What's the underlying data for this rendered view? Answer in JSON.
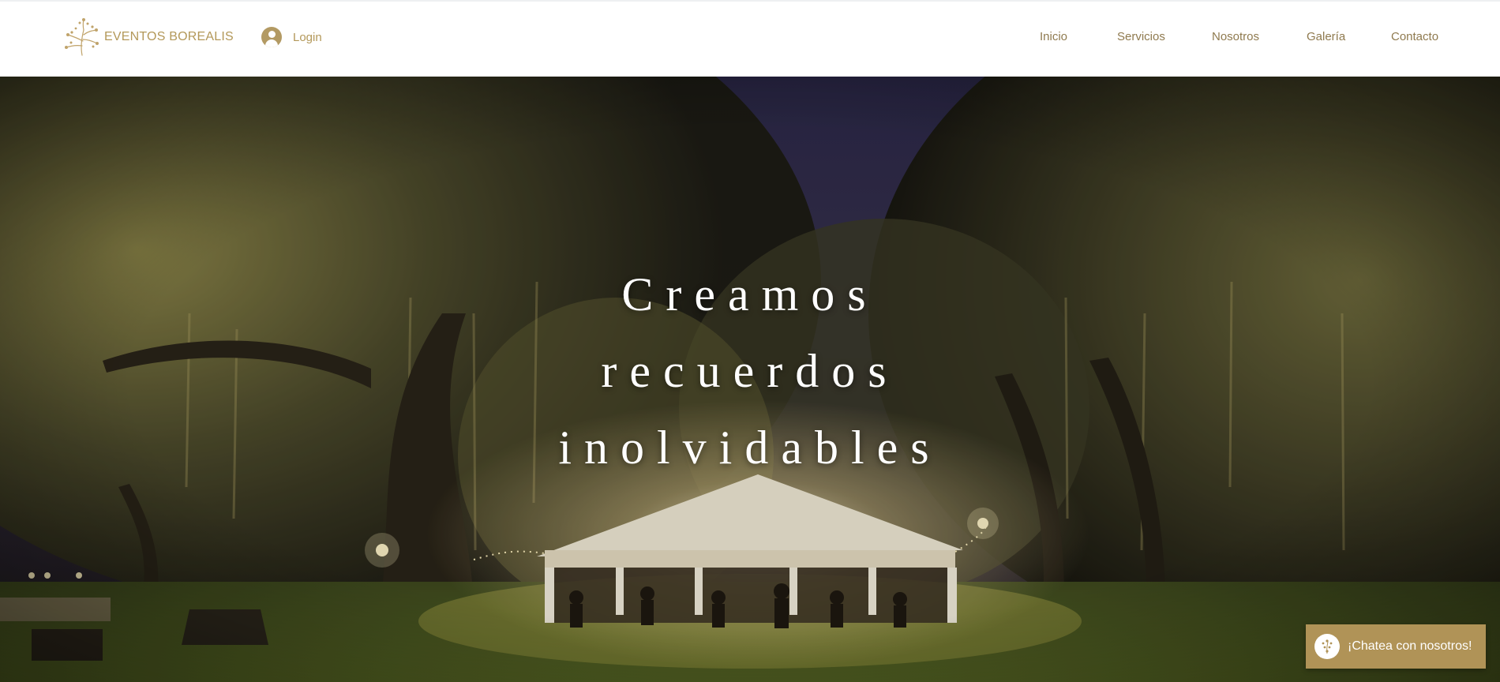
{
  "brand": {
    "name": "EVENTOS BOREALIS",
    "color": "#b39859"
  },
  "login": {
    "label": "Login"
  },
  "nav": {
    "items": [
      {
        "label": "Inicio"
      },
      {
        "label": "Servicios"
      },
      {
        "label": "Nosotros"
      },
      {
        "label": "Galería"
      },
      {
        "label": "Contacto"
      }
    ]
  },
  "hero": {
    "heading_lines": [
      "Creamos",
      "recuerdos",
      "inolvidables"
    ],
    "image_description": "night outdoor event: illuminated white tent under moss-draped oak trees with guests at tables"
  },
  "chat": {
    "label": "¡Chatea con nosotros!",
    "color": "#b09357"
  },
  "icons": {
    "logo": "branch-sprig-icon",
    "login": "user-avatar-icon",
    "chat": "chat-avatar-icon"
  }
}
